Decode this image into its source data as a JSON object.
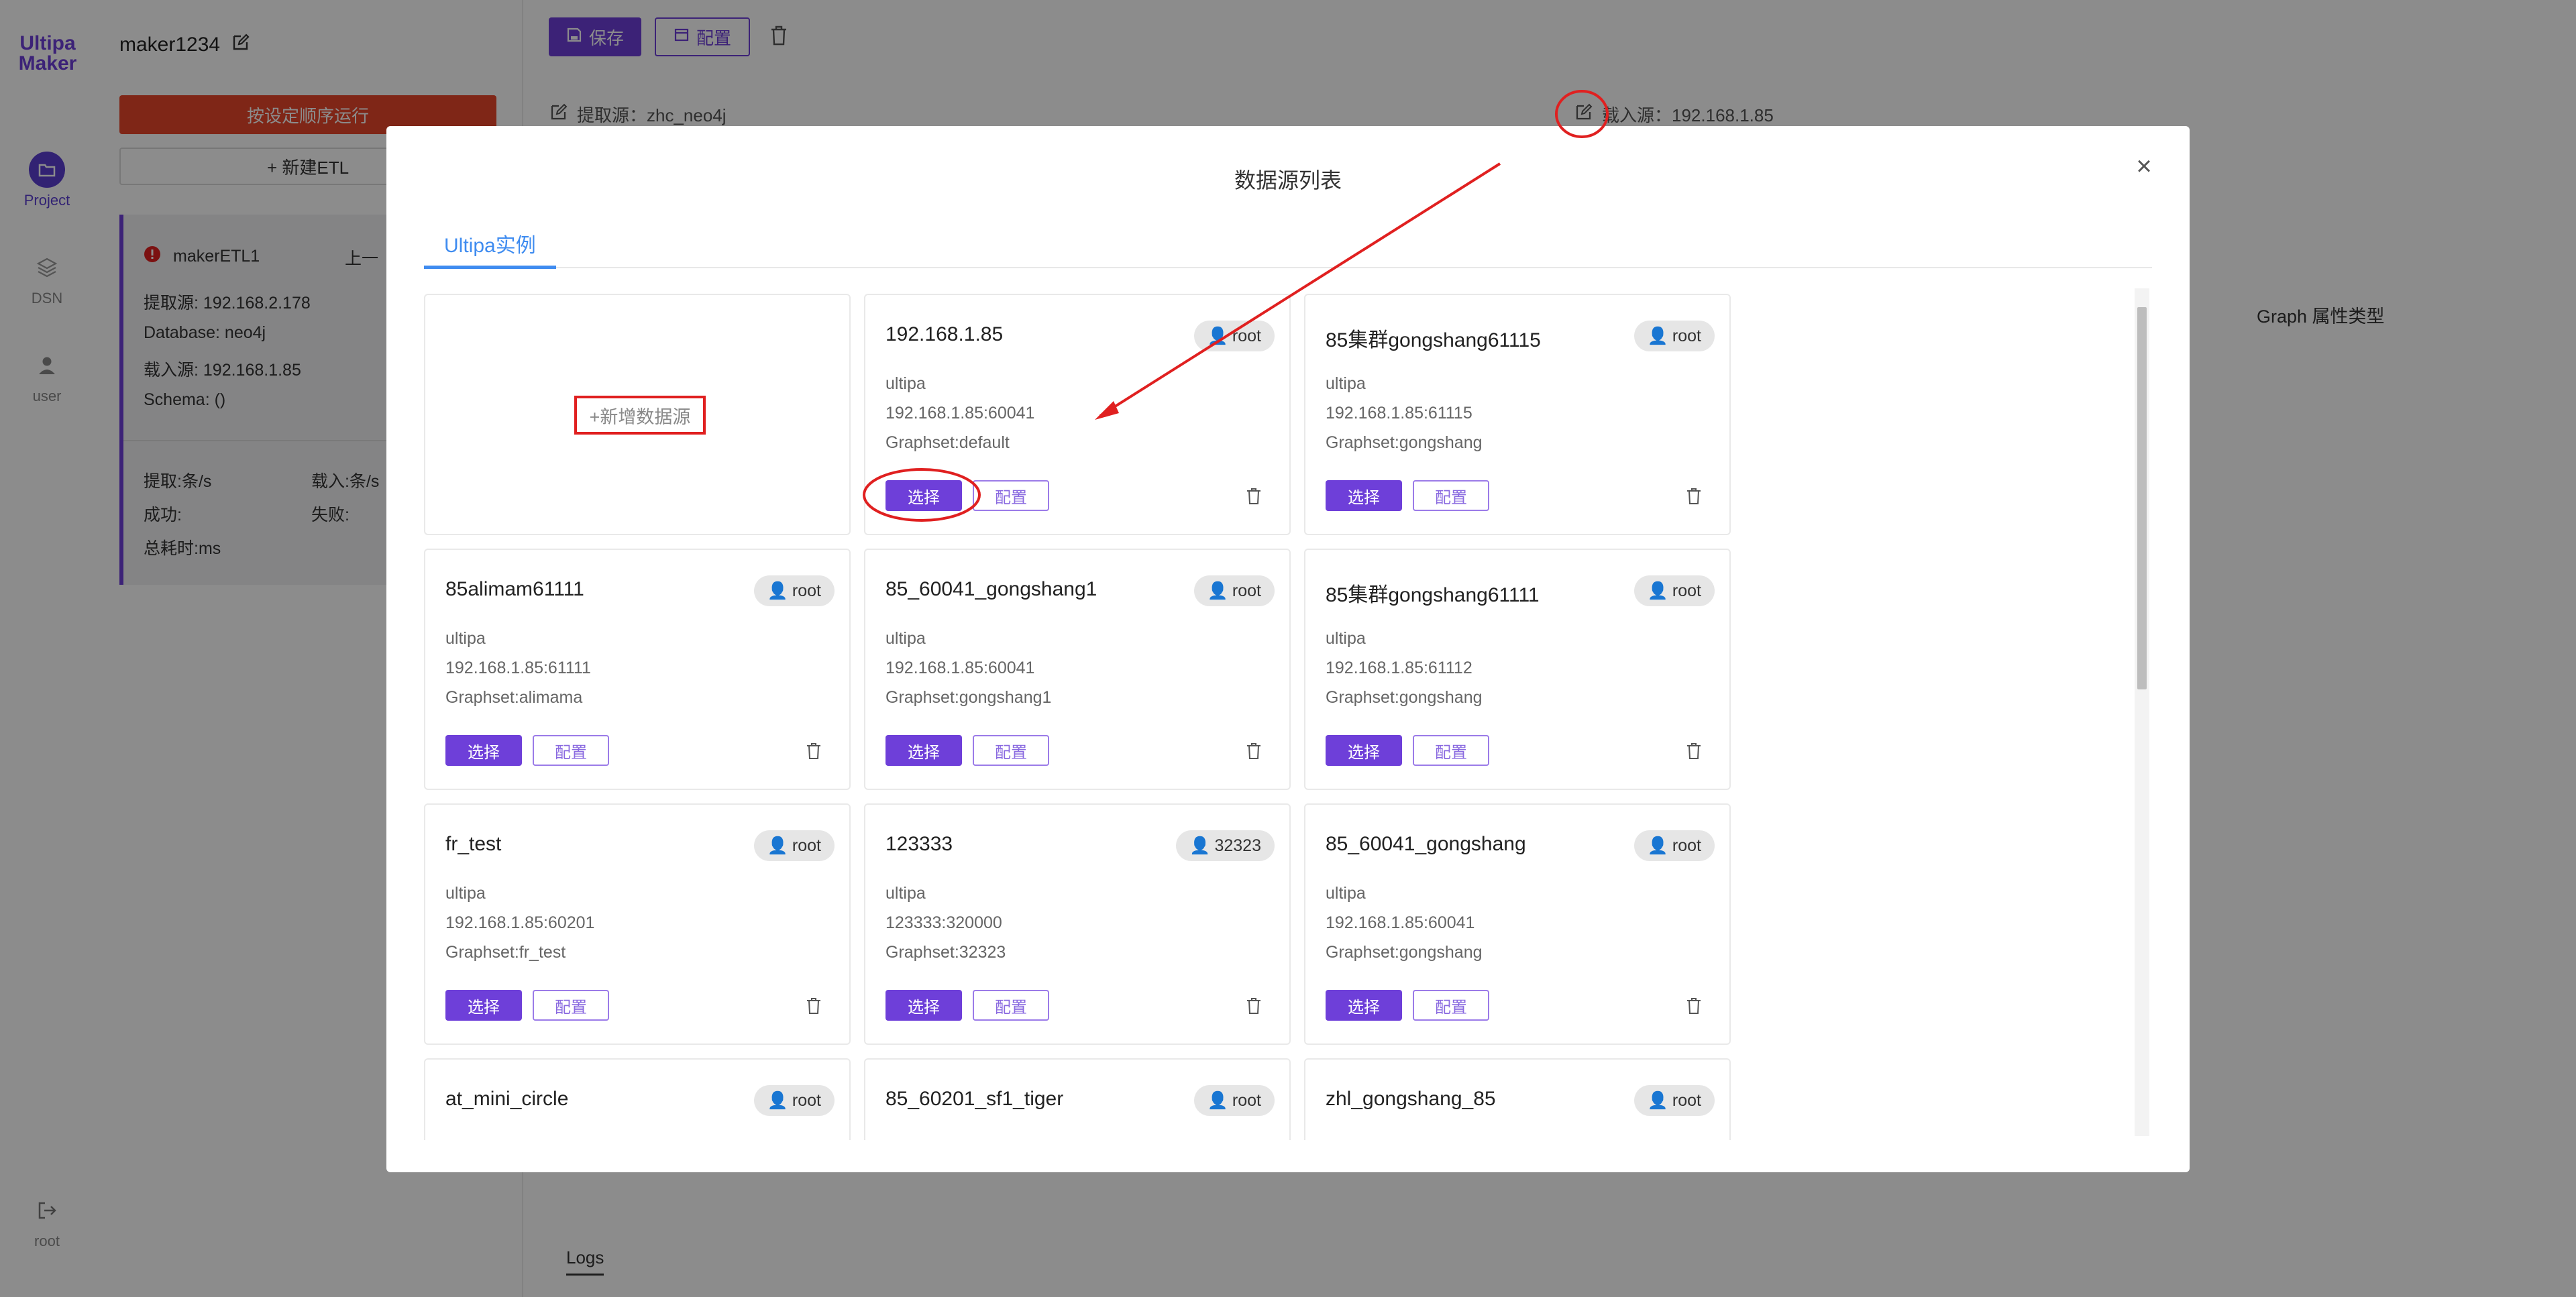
{
  "brand": {
    "logo_line1": "Ultipa",
    "logo_line2": "Maker"
  },
  "rail": [
    {
      "label": "Project",
      "icon": "folder-icon"
    },
    {
      "label": "DSN",
      "icon": "layers-icon"
    },
    {
      "label": "user",
      "icon": "user-icon"
    },
    {
      "label": "root",
      "icon": "logout-icon"
    }
  ],
  "project": {
    "name": "maker1234",
    "run_label": "按设定顺序运行",
    "new_etl_label": "+ 新建ETL",
    "etl": {
      "name": "makerETL1",
      "prev": "上一",
      "source": "提取源: 192.168.2.178",
      "database": "Database: neo4j",
      "target": "载入源: 192.168.1.85",
      "schema": "Schema: ()",
      "extract_rate": "提取:条/s",
      "load_rate": "载入:条/s",
      "success": "成功:",
      "fail": "失败:",
      "total_time": "总耗时:ms"
    }
  },
  "toolbar": {
    "save": "保存",
    "config": "配置"
  },
  "header": {
    "source": "提取源：zhc_neo4j",
    "target": "载入源：192.168.1.85"
  },
  "side_title": "Graph 属性类型",
  "logs_tab": "Logs",
  "modal": {
    "title": "数据源列表",
    "tab": "Ultipa实例",
    "add_label": "+新增数据源",
    "select_label": "选择",
    "config_label": "配置",
    "cards": [
      {
        "name": "192.168.1.85",
        "user": "root",
        "type": "ultipa",
        "addr": "192.168.1.85:60041",
        "graphset": "Graphset:default"
      },
      {
        "name": "85集群gongshang61115",
        "user": "root",
        "type": "ultipa",
        "addr": "192.168.1.85:61115",
        "graphset": "Graphset:gongshang"
      },
      {
        "name": "85alimam61111",
        "user": "root",
        "type": "ultipa",
        "addr": "192.168.1.85:61111",
        "graphset": "Graphset:alimama"
      },
      {
        "name": "85_60041_gongshang1",
        "user": "root",
        "type": "ultipa",
        "addr": "192.168.1.85:60041",
        "graphset": "Graphset:gongshang1"
      },
      {
        "name": "85集群gongshang61111",
        "user": "root",
        "type": "ultipa",
        "addr": "192.168.1.85:61112",
        "graphset": "Graphset:gongshang"
      },
      {
        "name": "fr_test",
        "user": "root",
        "type": "ultipa",
        "addr": "192.168.1.85:60201",
        "graphset": "Graphset:fr_test"
      },
      {
        "name": "123333",
        "user": "32323",
        "type": "ultipa",
        "addr": "123333:320000",
        "graphset": "Graphset:32323"
      },
      {
        "name": "85_60041_gongshang",
        "user": "root",
        "type": "ultipa",
        "addr": "192.168.1.85:60041",
        "graphset": "Graphset:gongshang"
      },
      {
        "name": "at_mini_circle",
        "user": "root"
      },
      {
        "name": "85_60201_sf1_tiger",
        "user": "root"
      },
      {
        "name": "zhl_gongshang_85",
        "user": "root"
      }
    ]
  },
  "colors": {
    "accent": "#6e3fd9",
    "run": "#e8452a",
    "tab": "#3f8cf0",
    "annotation": "#e02020"
  }
}
